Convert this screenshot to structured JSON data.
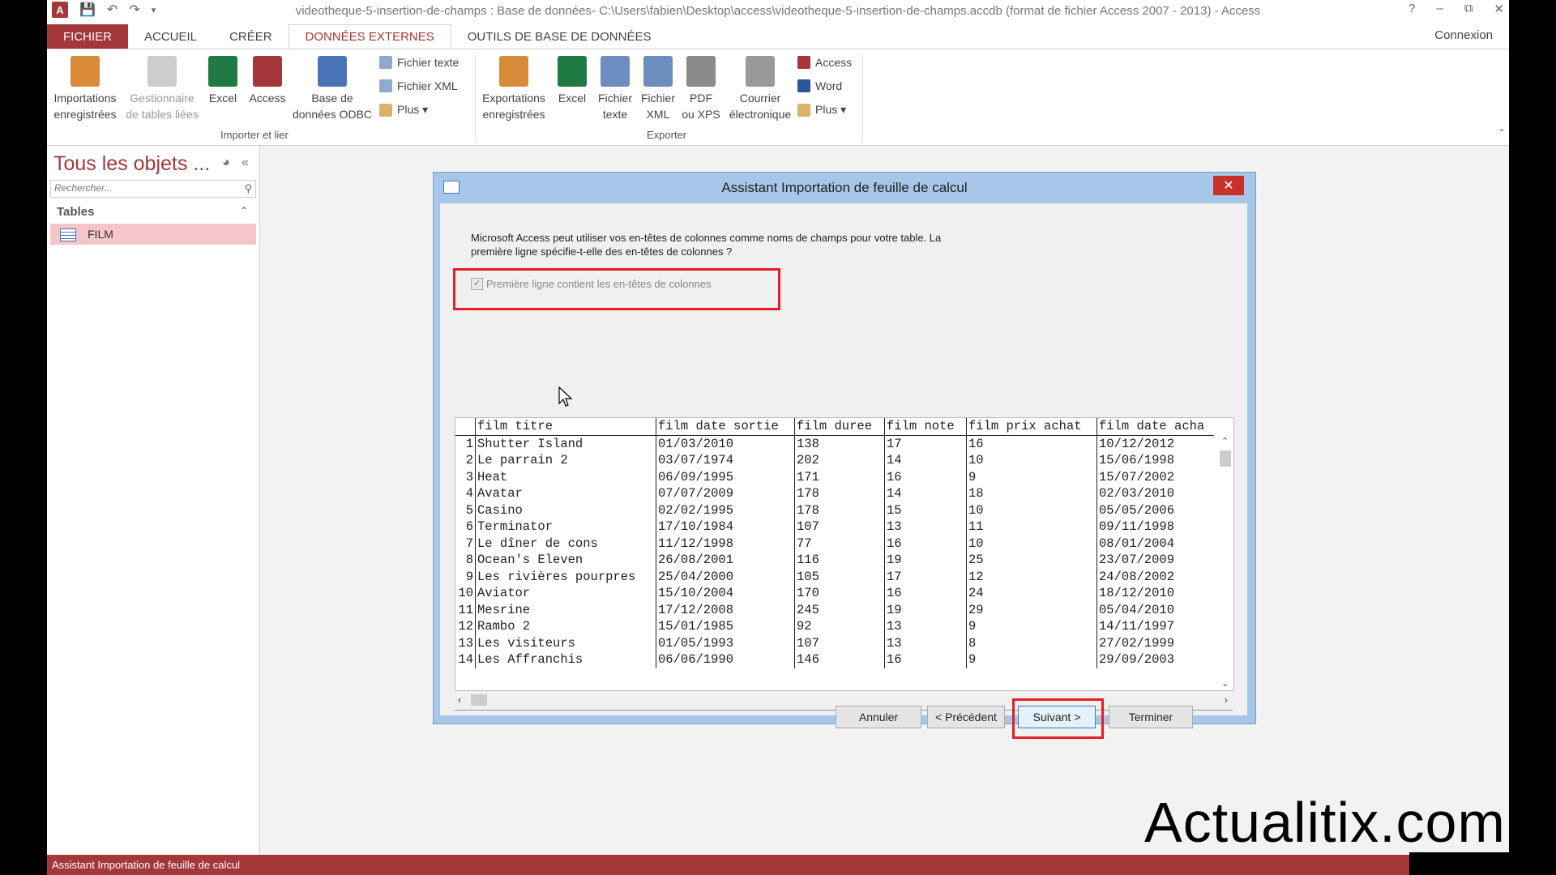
{
  "window": {
    "title": "videotheque-5-insertion-de-champs : Base de données- C:\\Users\\fabien\\Desktop\\access\\videotheque-5-insertion-de-champs.accdb (format de fichier Access 2007 - 2013) - Access",
    "logo_letter": "A",
    "controls": [
      "?",
      "–",
      "⧉",
      "✕"
    ]
  },
  "ribbon": {
    "tabs": [
      "FICHIER",
      "ACCUEIL",
      "CRÉER",
      "DONNÉES EXTERNES",
      "OUTILS DE BASE DE DONNÉES"
    ],
    "active_tab": "DONNÉES EXTERNES",
    "connexion": "Connexion",
    "import_group": {
      "label": "Importer et lier",
      "large_buttons": [
        {
          "line1": "Importations",
          "line2": "enregistrées",
          "icon": "saved-imports-icon",
          "color": "#d98b3a"
        },
        {
          "line1": "Gestionnaire",
          "line2": "de tables liées",
          "icon": "linked-table-manager-icon",
          "color": "#bbbbbb"
        },
        {
          "line1": "Excel",
          "line2": "",
          "icon": "excel-icon",
          "color": "#1f7a43"
        },
        {
          "line1": "Access",
          "line2": "",
          "icon": "access-icon",
          "color": "#a4373a"
        },
        {
          "line1": "Base de",
          "line2": "données ODBC",
          "icon": "odbc-icon",
          "color": "#4a74b8"
        }
      ],
      "small_buttons": [
        "Fichier texte",
        "Fichier XML",
        "Plus ▾"
      ]
    },
    "export_group": {
      "label": "Exporter",
      "large_buttons": [
        {
          "line1": "Exportations",
          "line2": "enregistrées",
          "icon": "saved-exports-icon",
          "color": "#d98b3a"
        },
        {
          "line1": "Excel",
          "line2": "",
          "icon": "excel-icon",
          "color": "#1f7a43"
        },
        {
          "line1": "Fichier",
          "line2": "texte",
          "icon": "text-file-icon",
          "color": "#6c8ebf"
        },
        {
          "line1": "Fichier",
          "line2": "XML",
          "icon": "xml-file-icon",
          "color": "#6c8ebf"
        },
        {
          "line1": "PDF",
          "line2": "ou XPS",
          "icon": "pdf-icon",
          "color": "#8a8a8a"
        },
        {
          "line1": "Courrier",
          "line2": "électronique",
          "icon": "email-icon",
          "color": "#9a9a9a"
        }
      ],
      "small_buttons": [
        "Access",
        "Word",
        "Plus ▾"
      ]
    }
  },
  "nav": {
    "title": "Tous les objets ...",
    "search_placeholder": "Rechercher...",
    "group": "Tables",
    "items": [
      "FILM"
    ]
  },
  "status_bar": "Assistant Importation de feuille de calcul",
  "dialog": {
    "title": "Assistant Importation de feuille de calcul",
    "intro": "Microsoft Access peut utiliser vos en-têtes de colonnes comme noms de champs pour votre table. La première ligne spécifie-t-elle des en-têtes de colonnes ?",
    "checkbox_label": "Première ligne contient les en-têtes de colonnes",
    "checkbox_checked": true,
    "columns": [
      "film titre",
      "film date sortie",
      "film duree",
      "film note",
      "film prix achat",
      "film date acha"
    ],
    "rows": [
      [
        "1",
        "Shutter Island",
        "01/03/2010",
        "138",
        "17",
        "16",
        "10/12/2012"
      ],
      [
        "2",
        "Le parrain 2",
        "03/07/1974",
        "202",
        "14",
        "10",
        "15/06/1998"
      ],
      [
        "3",
        "Heat",
        "06/09/1995",
        "171",
        "16",
        "9",
        "15/07/2002"
      ],
      [
        "4",
        "Avatar",
        "07/07/2009",
        "178",
        "14",
        "18",
        "02/03/2010"
      ],
      [
        "5",
        "Casino",
        "02/02/1995",
        "178",
        "15",
        "10",
        "05/05/2006"
      ],
      [
        "6",
        "Terminator",
        "17/10/1984",
        "107",
        "13",
        "11",
        "09/11/1998"
      ],
      [
        "7",
        "Le dîner de cons",
        "11/12/1998",
        "77",
        "16",
        "10",
        "08/01/2004"
      ],
      [
        "8",
        "Ocean's Eleven",
        "26/08/2001",
        "116",
        "19",
        "25",
        "23/07/2009"
      ],
      [
        "9",
        "Les rivières pourpres",
        "25/04/2000",
        "105",
        "17",
        "12",
        "24/08/2002"
      ],
      [
        "10",
        "Aviator",
        "15/10/2004",
        "170",
        "16",
        "24",
        "18/12/2010"
      ],
      [
        "11",
        "Mesrine",
        "17/12/2008",
        "245",
        "19",
        "29",
        "05/04/2010"
      ],
      [
        "12",
        "Rambo 2",
        "15/01/1985",
        "92",
        "13",
        "9",
        "14/11/1997"
      ],
      [
        "13",
        "Les visiteurs",
        "01/05/1993",
        "107",
        "13",
        "8",
        "27/02/1999"
      ],
      [
        "14",
        "Les Affranchis",
        "06/06/1990",
        "146",
        "16",
        "9",
        "29/09/2003"
      ]
    ],
    "buttons": {
      "cancel": "Annuler",
      "previous": "< Précédent",
      "next": "Suivant >",
      "finish": "Terminer"
    },
    "highlight_color": "#e31e24"
  },
  "watermark": "Actualitix.com",
  "colors": {
    "access_red": "#a4373a",
    "dialog_frame": "#a6c7e7",
    "nav_selected": "#f4c6c9"
  }
}
